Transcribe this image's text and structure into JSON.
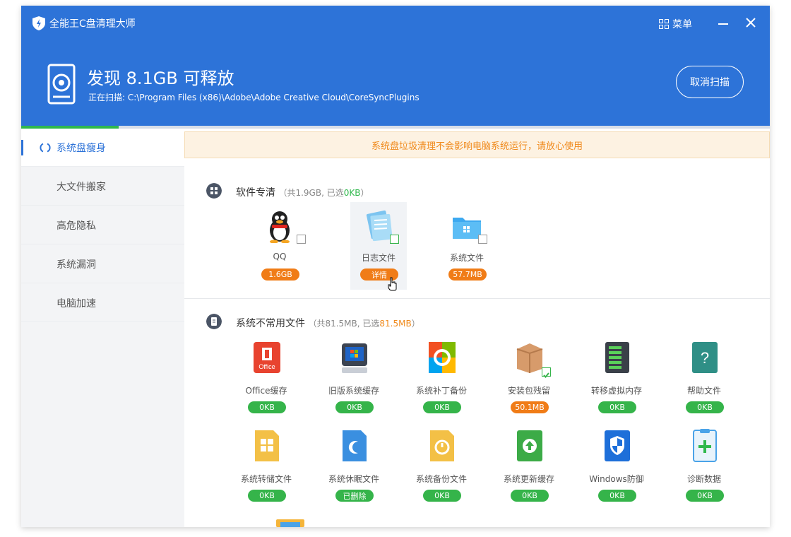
{
  "window": {
    "title": "全能王C盘清理大师",
    "menu_label": "菜单"
  },
  "header": {
    "headline": "发现 8.1GB 可释放",
    "scan_prefix": "正在扫描:",
    "scan_path": "C:\\Program Files (x86)\\Adobe\\Adobe Creative Cloud\\CoreSyncPlugins",
    "cancel_label": "取消扫描",
    "progress_fraction": 0.13
  },
  "sidebar": {
    "items": [
      {
        "label": "系统盘瘦身",
        "active": true
      },
      {
        "label": "大文件搬家",
        "active": false
      },
      {
        "label": "高危隐私",
        "active": false
      },
      {
        "label": "系统漏洞",
        "active": false
      },
      {
        "label": "电脑加速",
        "active": false
      }
    ]
  },
  "notice": "系统盘垃圾清理不会影响电脑系统运行，请放心使用",
  "section1": {
    "title": "软件专清",
    "note_pre": "（共1.9GB, 已选",
    "note_sel": "0KB",
    "note_post": "）",
    "items": [
      {
        "label": "QQ",
        "badge": "1.6GB",
        "badge_color": "orange",
        "icon": "qq-penguin-icon"
      },
      {
        "label": "日志文件",
        "badge": "详情",
        "badge_color": "orange",
        "icon": "log-file-icon"
      },
      {
        "label": "系统文件",
        "badge": "57.7MB",
        "badge_color": "orange",
        "icon": "system-folder-icon"
      }
    ]
  },
  "section2": {
    "title": "系统不常用文件",
    "note_pre": "（共81.5MB, 已选",
    "note_sel": "81.5MB",
    "note_post": "）",
    "items": [
      {
        "label": "Office缓存",
        "badge": "0KB",
        "badge_color": "green",
        "icon": "office-icon"
      },
      {
        "label": "旧版系统缓存",
        "badge": "0KB",
        "badge_color": "green",
        "icon": "old-system-icon"
      },
      {
        "label": "系统补丁备份",
        "badge": "0KB",
        "badge_color": "green",
        "icon": "patch-backup-icon"
      },
      {
        "label": "安装包残留",
        "badge": "50.1MB",
        "badge_color": "orange",
        "icon": "package-box-icon"
      },
      {
        "label": "转移虚拟内存",
        "badge": "0KB",
        "badge_color": "green",
        "icon": "virtual-memory-icon"
      },
      {
        "label": "帮助文件",
        "badge": "0KB",
        "badge_color": "green",
        "icon": "help-file-icon"
      },
      {
        "label": "系统转储文件",
        "badge": "0KB",
        "badge_color": "green",
        "icon": "dump-file-icon"
      },
      {
        "label": "系统休眠文件",
        "badge": "已删除",
        "badge_color": "green",
        "icon": "hibernate-file-icon"
      },
      {
        "label": "系统备份文件",
        "badge": "0KB",
        "badge_color": "green",
        "icon": "system-backup-icon"
      },
      {
        "label": "系统更新缓存",
        "badge": "0KB",
        "badge_color": "green",
        "icon": "update-cache-icon"
      },
      {
        "label": "Windows防御",
        "badge": "0KB",
        "badge_color": "green",
        "icon": "windows-defender-icon"
      },
      {
        "label": "诊断数据",
        "badge": "0KB",
        "badge_color": "green",
        "icon": "diagnostic-data-icon"
      }
    ]
  },
  "colors": {
    "header_blue": "#2d73d8",
    "orange": "#f07c17",
    "green": "#35b44a"
  }
}
